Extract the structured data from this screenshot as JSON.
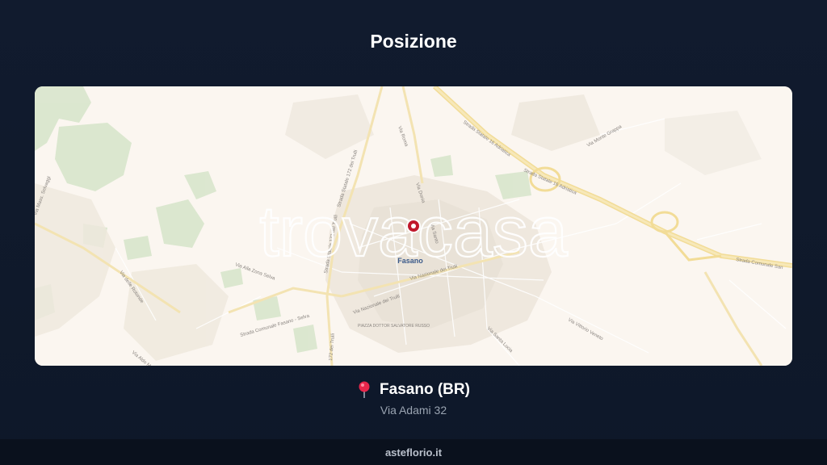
{
  "page": {
    "title": "Posizione"
  },
  "map": {
    "city_label": "Fasano",
    "watermark": "trovacasa",
    "roads": {
      "ss16_north": "Strada Statale 16 Adriatica",
      "ss16_east": "Strada Statale 16 Adriatica",
      "ss172_a": "Strada Statale 172 dei Trulli",
      "ss172_b": "Strada Statale 172 dei Trulli",
      "ss172_c": "172 dei Trulli",
      "via_nazionale_1": "Via Nazionale dei Trulli",
      "via_nazionale_2": "Via Nazionale dei Trulli",
      "via_roma": "Via Roma",
      "via_donia": "Via Donia",
      "via_ignoto": "Via Santo",
      "sc_san": "Strada Comunale San",
      "sc_fasano_selva": "Strada Comunale Fasano - Selva",
      "via_della_salute": "Via delle Rotonde",
      "via_vittorio": "Via Vittorio Veneto",
      "via_santa": "Via Santa Lucia",
      "via_alla": "Via Alla Zona Selva",
      "via_monte": "Via Monte Grappa",
      "via_mass": "Via Mass. Selvaggi",
      "piazza": "PIAZZA DOTTOR SALVATORE RUSSO",
      "via_aldo": "Via Aldo Moro"
    },
    "marker_color": "#c0182c"
  },
  "location": {
    "pin_icon": "pin-icon",
    "name": "Fasano (BR)",
    "address": "Via Adami 32"
  },
  "footer": {
    "site": "asteflorio.it"
  }
}
